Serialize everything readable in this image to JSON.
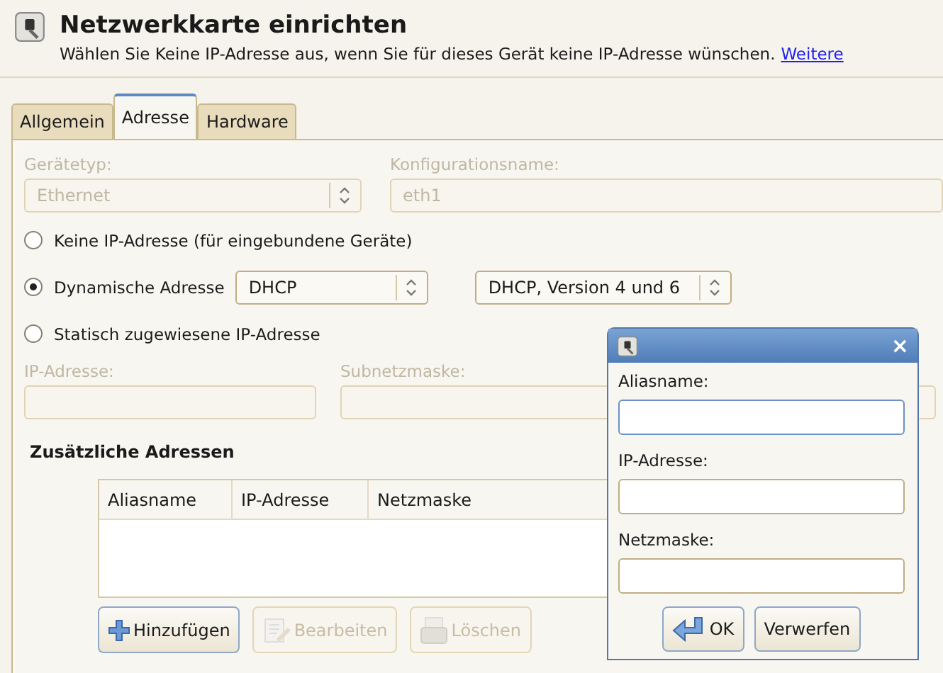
{
  "header": {
    "title": "Netzwerkkarte einrichten",
    "subtitle": "Wählen Sie Keine IP-Adresse aus, wenn Sie für dieses Gerät keine IP-Adresse wünschen.",
    "link": "Weitere"
  },
  "tabs": [
    {
      "label": "Allgemein",
      "selected": false
    },
    {
      "label": "Adresse",
      "selected": true
    },
    {
      "label": "Hardware",
      "selected": false
    }
  ],
  "device": {
    "type_label": "Gerätetyp:",
    "type_value": "Ethernet",
    "name_label": "Konfigurationsname:",
    "name_value": "eth1",
    "disabled": true
  },
  "radios": [
    {
      "label": "Keine IP-Adresse (für eingebundene Geräte)",
      "selected": false
    },
    {
      "label": "Dynamische Adresse",
      "selected": true
    },
    {
      "label": "Statisch zugewiesene IP-Adresse",
      "selected": false
    }
  ],
  "dhcp": {
    "mode": "DHCP",
    "version": "DHCP, Version 4 und 6"
  },
  "static": {
    "ip_label": "IP-Adresse:",
    "mask_label": "Subnetzmaske:",
    "disabled": true
  },
  "additional": {
    "title": "Zusätzliche Adressen",
    "columns": [
      "Aliasname",
      "IP-Adresse",
      "Netzmaske"
    ],
    "buttons": [
      {
        "label": "Hinzufügen",
        "kind": "add",
        "disabled": false
      },
      {
        "label": "Bearbeiten",
        "kind": "edit",
        "disabled": true
      },
      {
        "label": "Löschen",
        "kind": "delete",
        "disabled": true
      }
    ]
  },
  "popup": {
    "close": "×",
    "fields": [
      {
        "label": "Aliasname:",
        "focused": true
      },
      {
        "label": "IP-Adresse:",
        "focused": false
      },
      {
        "label": "Netzmaske:",
        "focused": false
      }
    ],
    "buttons": [
      {
        "label": "OK",
        "kind": "ok"
      },
      {
        "label": "Verwerfen",
        "kind": "cancel"
      }
    ]
  }
}
